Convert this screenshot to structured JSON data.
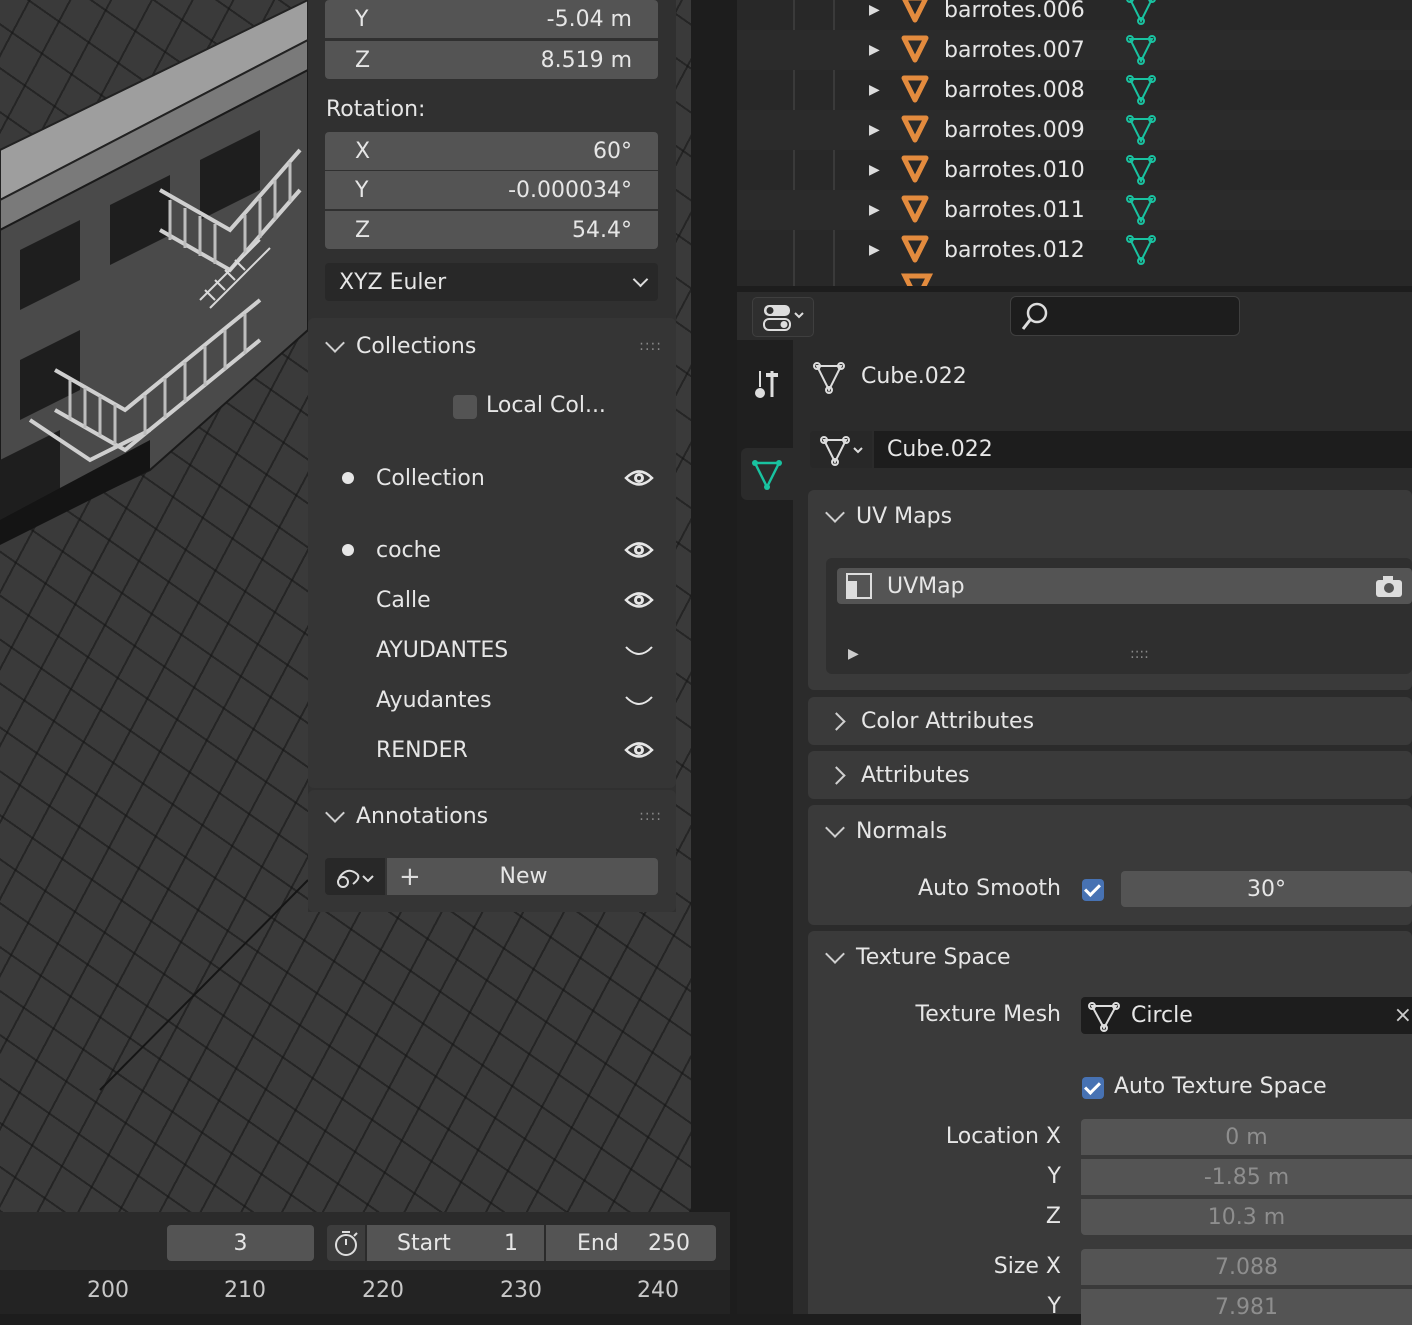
{
  "transform": {
    "loc_y_label": "Y",
    "loc_y_value": "-5.04 m",
    "loc_z_label": "Z",
    "loc_z_value": "8.519 m",
    "rotation_label": "Rotation:",
    "rot_x_label": "X",
    "rot_x_value": "60°",
    "rot_y_label": "Y",
    "rot_y_value": "-0.000034°",
    "rot_z_label": "Z",
    "rot_z_value": "54.4°",
    "rotation_mode": "XYZ Euler"
  },
  "collections": {
    "header": "Collections",
    "local_label": "Local Col...",
    "items": [
      {
        "name": "Collection",
        "active": true,
        "visible": true
      },
      {
        "name": "coche",
        "active": true,
        "visible": true
      },
      {
        "name": "Calle",
        "active": false,
        "visible": true
      },
      {
        "name": "AYUDANTES",
        "active": false,
        "visible": false
      },
      {
        "name": "Ayudantes",
        "active": false,
        "visible": false
      },
      {
        "name": "RENDER",
        "active": false,
        "visible": true
      }
    ]
  },
  "annotations": {
    "header": "Annotations",
    "new_label": "New"
  },
  "outliner": {
    "items": [
      "barrotes.006",
      "barrotes.007",
      "barrotes.008",
      "barrotes.009",
      "barrotes.010",
      "barrotes.011",
      "barrotes.012"
    ]
  },
  "properties": {
    "object_name": "Cube.022",
    "mesh_name": "Cube.022",
    "uv_maps": {
      "header": "UV Maps",
      "item": "UVMap"
    },
    "color_attributes": "Color Attributes",
    "attributes": "Attributes",
    "normals": {
      "header": "Normals",
      "auto_smooth_label": "Auto Smooth",
      "angle": "30°"
    },
    "texture_space": {
      "header": "Texture Space",
      "texture_mesh_label": "Texture Mesh",
      "texture_mesh_value": "Circle",
      "auto_label": "Auto Texture Space",
      "location_x_label": "Location X",
      "location_x": "0 m",
      "y_label": "Y",
      "location_y": "-1.85 m",
      "z_label": "Z",
      "location_z": "10.3 m",
      "size_x_label": "Size X",
      "size_x": "7.088",
      "size_y_label": "Y",
      "size_y": "7.981"
    }
  },
  "timeline": {
    "current_frame": "3",
    "start_label": "Start",
    "start_value": "1",
    "end_label": "End",
    "end_value": "250",
    "ruler": [
      "200",
      "210",
      "220",
      "230",
      "240"
    ]
  },
  "colors": {
    "accent": "#4772b3",
    "mesh_icon": "#19c2a0",
    "object_icon": "#e38b3e"
  }
}
